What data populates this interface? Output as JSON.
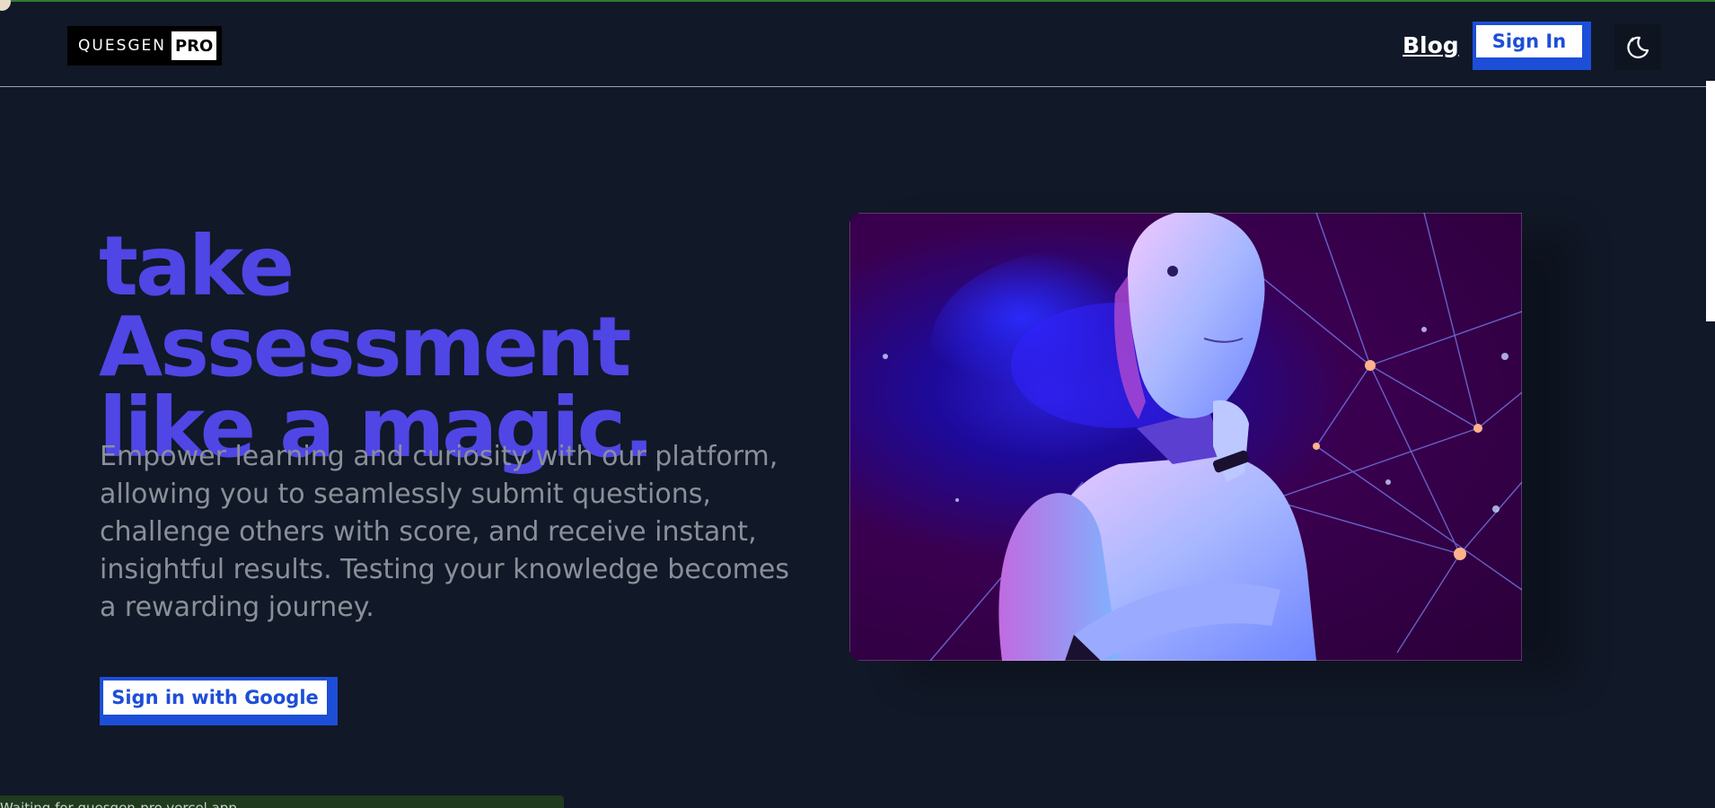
{
  "header": {
    "logo_text": "QUESGEN",
    "logo_badge": "PRO",
    "blog_label": "Blog",
    "signin_label": "Sign In",
    "theme_icon": "moon-stars-icon"
  },
  "hero": {
    "title_line1": "take Assessment",
    "title_line2": "like a magic.",
    "description": "Empower learning and curiosity with our platform, allowing you to seamlessly submit questions, challenge others with score, and receive instant, insightful results. Testing your knowledge becomes a rewarding journey.",
    "cta_label": "Sign in with Google",
    "image_subject": "robot-thinking-illustration"
  },
  "status": {
    "text": "Waiting for quesgen-pro.vercel.app..."
  },
  "colors": {
    "background": "#111827",
    "accent": "#4f46e5",
    "button_border": "#1d4ed8",
    "muted_text": "#8b8f99"
  }
}
